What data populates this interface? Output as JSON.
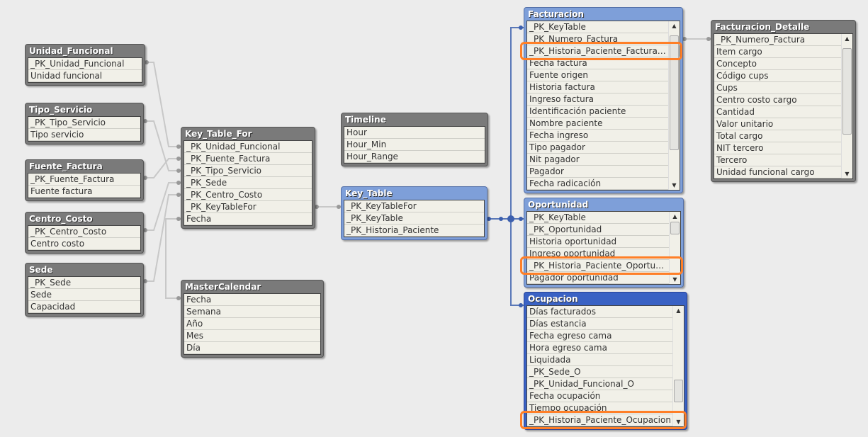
{
  "tables": [
    {
      "id": "unidad_funcional",
      "title": "Unidad_Funcional",
      "style": "gray",
      "fields": [
        "_PK_Unidad_Funcional",
        "Unidad funcional"
      ]
    },
    {
      "id": "tipo_servicio",
      "title": "Tipo_Servicio",
      "style": "gray",
      "fields": [
        "_PK_Tipo_Servicio",
        "Tipo servicio"
      ]
    },
    {
      "id": "fuente_factura",
      "title": "Fuente_Factura",
      "style": "gray",
      "fields": [
        "_PK_Fuente_Factura",
        "Fuente factura"
      ]
    },
    {
      "id": "centro_costo",
      "title": "Centro_Costo",
      "style": "gray",
      "fields": [
        "_PK_Centro_Costo",
        "Centro costo"
      ]
    },
    {
      "id": "sede",
      "title": "Sede",
      "style": "gray",
      "fields": [
        "_PK_Sede",
        "Sede",
        "Capacidad"
      ]
    },
    {
      "id": "key_table_for",
      "title": "Key_Table_For",
      "style": "gray",
      "fields": [
        "_PK_Unidad_Funcional",
        "_PK_Fuente_Factura",
        "_PK_Tipo_Servicio",
        "_PK_Sede",
        "_PK_Centro_Costo",
        "_PK_KeyTableFor",
        "Fecha"
      ]
    },
    {
      "id": "mastercalendar",
      "title": "MasterCalendar",
      "style": "gray",
      "fields": [
        "Fecha",
        "Semana",
        "Año",
        "Mes",
        "Día"
      ]
    },
    {
      "id": "timeline",
      "title": "Timeline",
      "style": "gray",
      "fields": [
        "Hour",
        "Hour_Min",
        "Hour_Range"
      ]
    },
    {
      "id": "key_table",
      "title": "Key_Table",
      "style": "blue",
      "fields": [
        "_PK_KeyTableFor",
        "_PK_KeyTable",
        "_PK_Historia_Paciente"
      ]
    },
    {
      "id": "facturacion",
      "title": "Facturacion",
      "style": "blue",
      "scroll": true,
      "highlight": 2,
      "fields": [
        "_PK_KeyTable",
        "_PK_Numero_Factura",
        "_PK_Historia_Paciente_Facturac...",
        "Fecha factura",
        "Fuente origen",
        "Historia factura",
        "Ingreso factura",
        "Identificación paciente",
        "Nombre paciente",
        "Fecha ingreso",
        "Tipo pagador",
        "Nit pagador",
        "Pagador",
        "Fecha radicación"
      ]
    },
    {
      "id": "facturacion_detalle",
      "title": "Facturacion_Detalle",
      "style": "gray",
      "scroll": true,
      "fields": [
        "_PK_Numero_Factura",
        "Item cargo",
        "Concepto",
        "Código cups",
        "Cups",
        "Centro costo cargo",
        "Cantidad",
        "Valor unitario",
        "Total cargo",
        "NIT tercero",
        "Tercero",
        "Unidad funcional cargo"
      ]
    },
    {
      "id": "oportunidad",
      "title": "Oportunidad",
      "style": "blue",
      "scroll": true,
      "highlight": 4,
      "fields": [
        "_PK_KeyTable",
        "_PK_Oportunidad",
        "Historia oportunidad",
        "Ingreso oportunidad",
        "_PK_Historia_Paciente_Oportuni...",
        "Pagador oportunidad"
      ]
    },
    {
      "id": "ocupacion",
      "title": "Ocupacion",
      "style": "dark",
      "scroll": true,
      "highlight": 9,
      "fields": [
        "Días facturados",
        "Días estancia",
        "Fecha egreso cama",
        "Hora egreso cama",
        "Liquidada",
        "_PK_Sede_O",
        "_PK_Unidad_Funcional_O",
        "Fecha ocupación",
        "Tiempo ocupación",
        "_PK_Historia_Paciente_Ocupacion"
      ]
    }
  ],
  "colors": {
    "highlight": "#ff7f27",
    "link_gray": "#c8c8c8",
    "link_blue": "#5a78b8"
  }
}
